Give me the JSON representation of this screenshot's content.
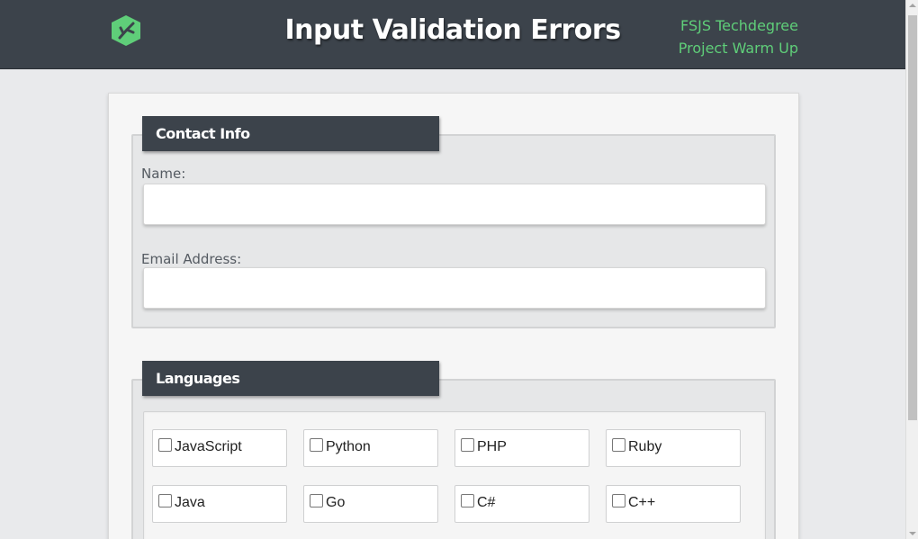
{
  "header": {
    "title": "Input Validation Errors",
    "subtitle_line1": "FSJS Techdegree",
    "subtitle_line2": "Project Warm Up",
    "logo_icon": "treehouse-logo-icon",
    "accent_color": "#5fce79"
  },
  "contact": {
    "legend": "Contact Info",
    "name_label": "Name:",
    "name_value": "",
    "email_label": "Email Address:",
    "email_value": ""
  },
  "languages": {
    "legend": "Languages",
    "items": [
      {
        "label": "JavaScript",
        "checked": false
      },
      {
        "label": "Python",
        "checked": false
      },
      {
        "label": "PHP",
        "checked": false
      },
      {
        "label": "Ruby",
        "checked": false
      },
      {
        "label": "Java",
        "checked": false
      },
      {
        "label": "Go",
        "checked": false
      },
      {
        "label": "C#",
        "checked": false
      },
      {
        "label": "C++",
        "checked": false
      }
    ]
  }
}
